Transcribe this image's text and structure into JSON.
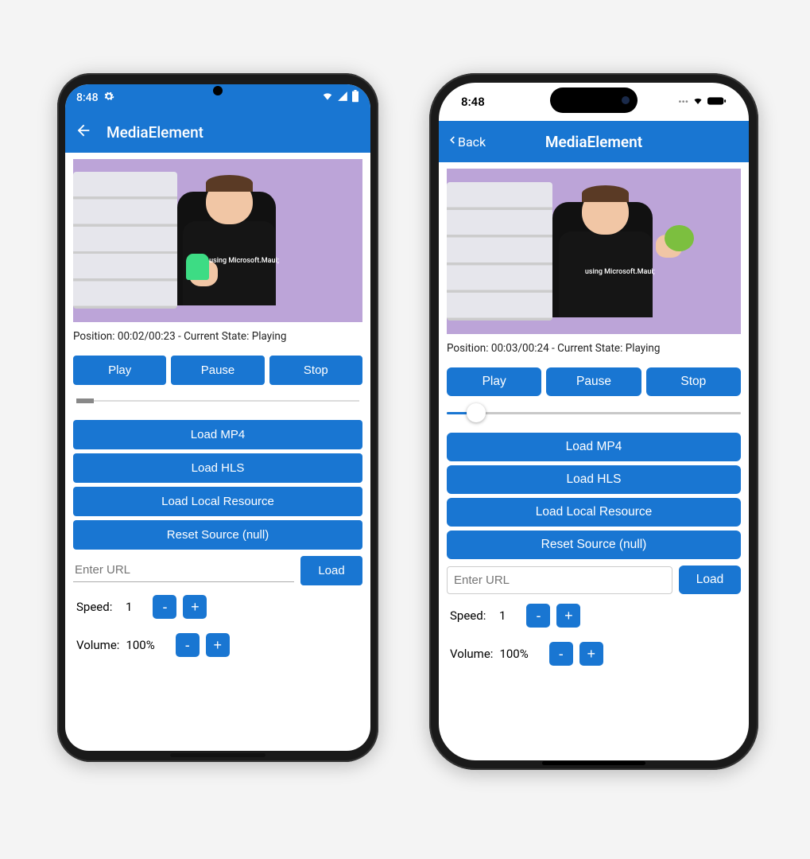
{
  "brand_color": "#1976d2",
  "android": {
    "status": {
      "time": "8:48"
    },
    "nav": {
      "title": "MediaElement"
    },
    "video": {
      "shirt": "using Microsoft.Maui;"
    },
    "position_line": "Position: 00:02/00:23 - Current State: Playing",
    "buttons": {
      "play": "Play",
      "pause": "Pause",
      "stop": "Stop"
    },
    "loaders": {
      "mp4": "Load MP4",
      "hls": "Load HLS",
      "local": "Load Local Resource",
      "reset": "Reset Source (null)"
    },
    "url": {
      "placeholder": "Enter URL",
      "load": "Load"
    },
    "speed": {
      "label": "Speed:",
      "value": "1",
      "minus": "-",
      "plus": "+"
    },
    "volume": {
      "label": "Volume:",
      "value": "100%",
      "minus": "-",
      "plus": "+"
    }
  },
  "ios": {
    "status": {
      "time": "8:48"
    },
    "nav": {
      "back": "Back",
      "title": "MediaElement"
    },
    "video": {
      "shirt": "using Microsoft.Maui;"
    },
    "position_line": "Position: 00:03/00:24 - Current State: Playing",
    "buttons": {
      "play": "Play",
      "pause": "Pause",
      "stop": "Stop"
    },
    "loaders": {
      "mp4": "Load MP4",
      "hls": "Load HLS",
      "local": "Load Local Resource",
      "reset": "Reset Source (null)"
    },
    "url": {
      "placeholder": "Enter URL",
      "load": "Load"
    },
    "speed": {
      "label": "Speed:",
      "value": "1",
      "minus": "-",
      "plus": "+"
    },
    "volume": {
      "label": "Volume:",
      "value": "100%",
      "minus": "-",
      "plus": "+"
    }
  }
}
